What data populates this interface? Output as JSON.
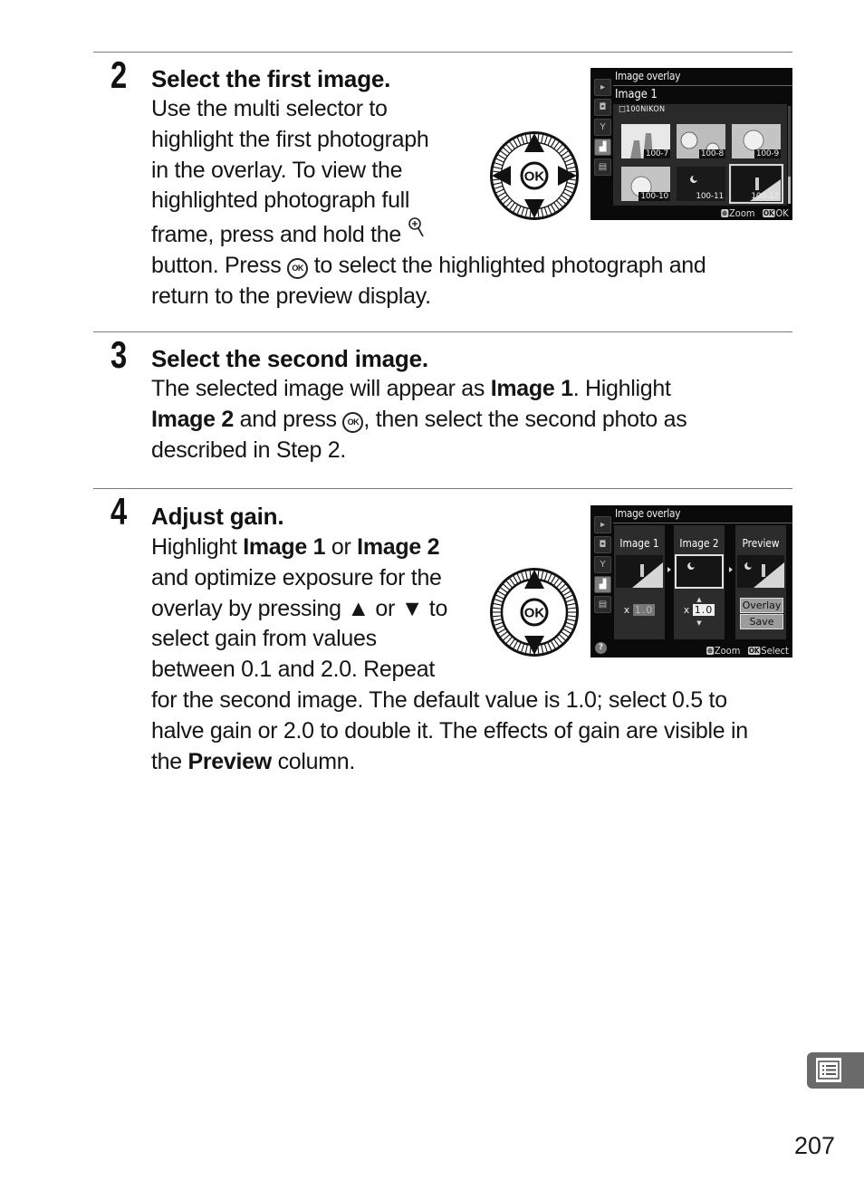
{
  "steps": [
    {
      "number": "2",
      "title": "Select the first image.",
      "lines": [
        "Use the multi selector to",
        "highlight the first photograph",
        "in the overlay.  To view the",
        "highlighted photograph full",
        "frame, press and hold the",
        "button.  Press",
        "to select the highlighted photograph and",
        "return to the preview display."
      ]
    },
    {
      "number": "3",
      "title": "Select the second image.",
      "parts": {
        "l1a": "The selected image will appear as ",
        "l1b": "Image 1",
        "l1c": ".  Highlight",
        "l2a": "Image 2",
        "l2b": " and press ",
        "l2c": ", then select the second photo as",
        "l3": "described in Step 2."
      }
    },
    {
      "number": "4",
      "title": "Adjust gain.",
      "parts": {
        "l1a": "Highlight ",
        "l1b": "Image 1",
        "l1c": " or ",
        "l1d": "Image 2",
        "l2": "and optimize exposure for the",
        "l3a": "overlay by pressing ",
        "l3b": "▲",
        "l3c": " or ",
        "l3d": "▼",
        "l3e": " to",
        "l4": "select gain from values",
        "l5": "between 0.1 and 2.0.  Repeat",
        "l6": "for the second image.  The default value is 1.0; select 0.5 to",
        "l7": "halve gain or 2.0 to double it.  The effects of gain are visible in",
        "l8a": "the ",
        "l8b": "Preview",
        "l8c": " column."
      }
    }
  ],
  "ok_glyph": "OK",
  "screen1": {
    "title": "Image overlay",
    "subtitle": "Image 1",
    "folder": "□100NIKON",
    "thumbnails": [
      "100-7",
      "100-8",
      "100-9",
      "100-10",
      "100-11",
      "100-12"
    ],
    "selected": "100-12",
    "footer_zoom_badge": "⊕",
    "footer_zoom": "Zoom",
    "footer_ok_badge": "OK",
    "footer_ok": "OK"
  },
  "screen2": {
    "title": "Image overlay",
    "columns": [
      "Image 1",
      "Image 2",
      "Preview"
    ],
    "gain_prefix": "x",
    "image1_gain": "1.0",
    "image2_gain": "1.0",
    "buttons": [
      "Overlay",
      "Save"
    ],
    "help": "?",
    "footer_zoom_badge": "⊕",
    "footer_zoom": "Zoom",
    "footer_ok_badge": "OK",
    "footer_select": "Select"
  },
  "selector_center": "OK",
  "page_number": "207"
}
